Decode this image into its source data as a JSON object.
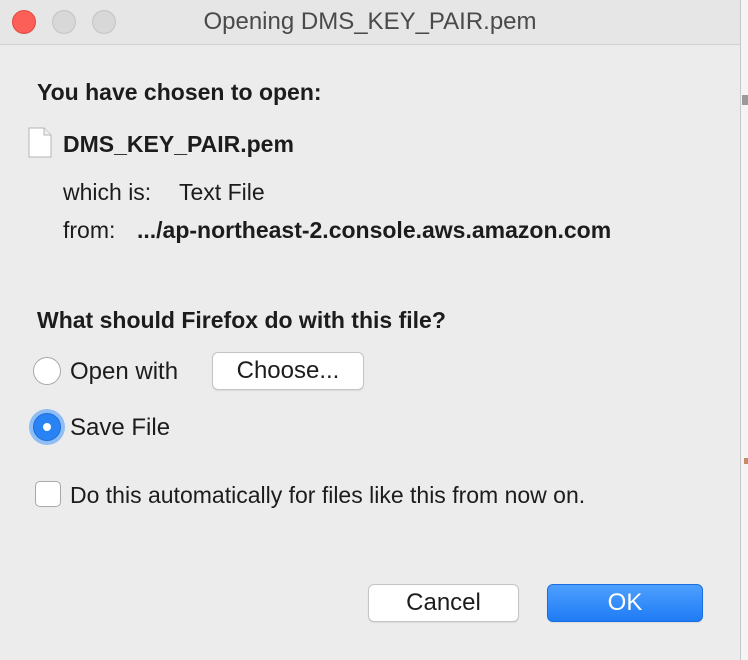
{
  "window": {
    "title": "Opening DMS_KEY_PAIR.pem"
  },
  "dialog": {
    "heading": "You have chosen to open:",
    "file_name": "DMS_KEY_PAIR.pem",
    "which_is_label": "which is:",
    "which_is_value": "Text File",
    "from_label": "from:",
    "from_value": ".../ap-northeast-2.console.aws.amazon.com",
    "question": "What should Firefox do with this file?",
    "open_with_label": "Open with",
    "choose_button": "Choose...",
    "save_file_label": "Save File",
    "save_file_selected": true,
    "auto_checkbox_label": "Do this automatically for files like this from now on.",
    "auto_checkbox_checked": false
  },
  "buttons": {
    "cancel": "Cancel",
    "ok": "OK"
  },
  "colors": {
    "accent": "#2a83f5",
    "close_button": "#fc5f57"
  },
  "icons": {
    "file": "file-icon"
  }
}
